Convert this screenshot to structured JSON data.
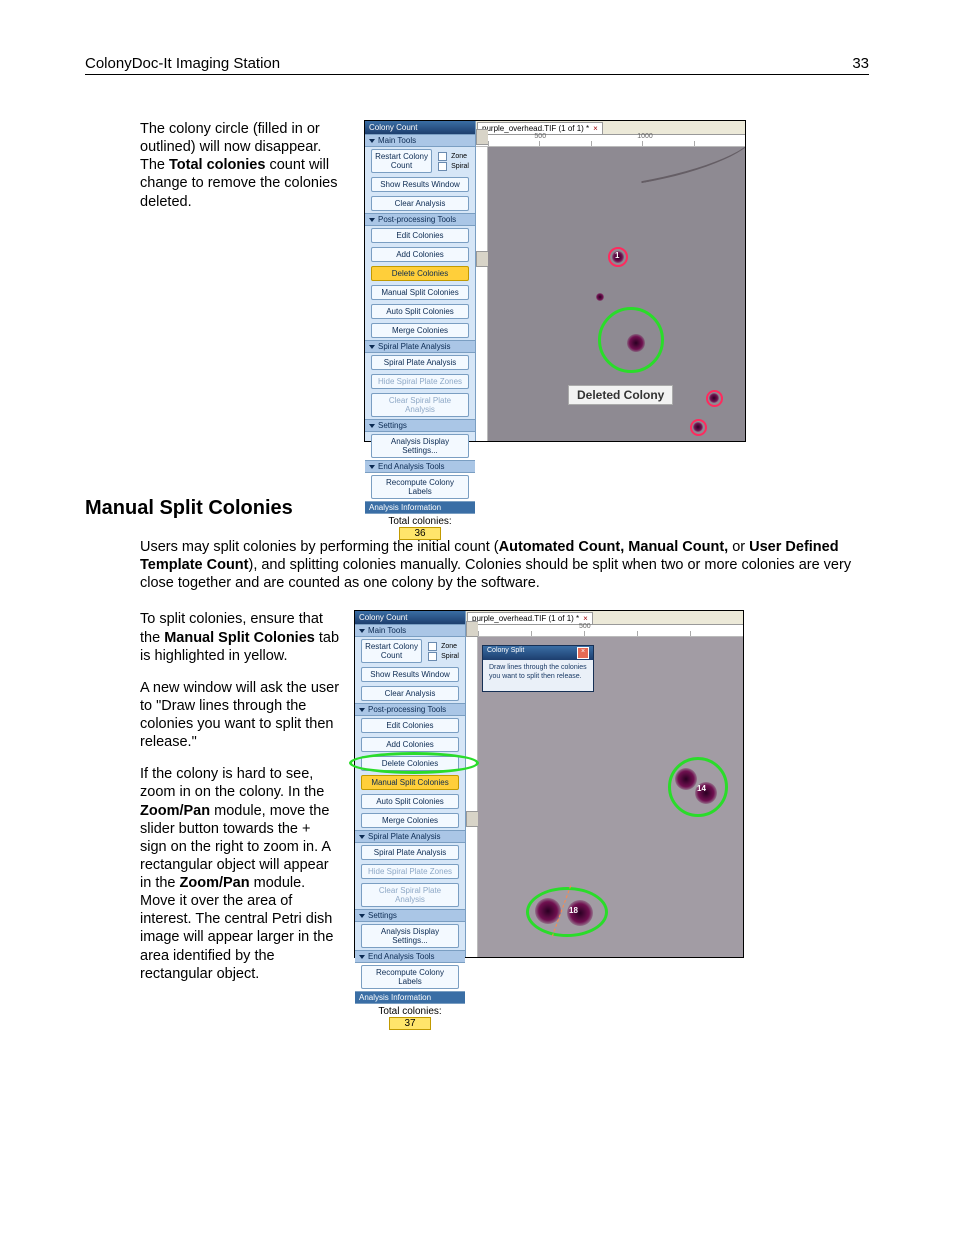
{
  "header": {
    "title": "ColonyDoc-It Imaging Station",
    "page": "33"
  },
  "para1": {
    "line1": "The colony circle (filled in or outlined) will now disappear. The ",
    "bold1": "Total colonies",
    "line2": " count will change to remove the colonies deleted."
  },
  "fig1": {
    "title": "Colony Count",
    "tab": "purple_overhead.TIF (1 of 1) *",
    "ruler": [
      "500",
      "1000"
    ],
    "sidebar": {
      "main": "Main Tools",
      "restart": "Restart Colony Count",
      "zone": "Zone",
      "spiral": "Spiral",
      "show": "Show Results Window",
      "clear": "Clear Analysis",
      "post": "Post-processing Tools",
      "edit": "Edit Colonies",
      "add": "Add Colonies",
      "delete": "Delete Colonies",
      "msplit": "Manual Split Colonies",
      "asplit": "Auto Split Colonies",
      "merge": "Merge Colonies",
      "spa": "Spiral Plate Analysis",
      "spabtn": "Spiral Plate Analysis",
      "hsp": "Hide Spiral Plate Zones",
      "csp": "Clear Spiral Plate Analysis",
      "settings": "Settings",
      "ads": "Analysis Display Settings...",
      "eat": "End Analysis Tools",
      "recompute": "Recompute Colony Labels",
      "info": "Analysis Information",
      "totals_label": "Total colonies:",
      "totals_num": "36"
    },
    "label": "Deleted Colony",
    "colony_id": "1"
  },
  "section2": {
    "heading": "Manual Split Colonies",
    "intro_a": "Users may split colonies by performing the initial count (",
    "intro_b": "Automated Count, Manual Count,",
    "intro_c": " or ",
    "intro_d": "User Defined Template Count",
    "intro_e": "), and splitting colonies manually.  Colonies should be split when two or more colonies are very close together and are counted as one colony by the software.",
    "p1a": "To split colonies, ensure that the ",
    "p1b": "Manual Split Colonies",
    "p1c": " tab is highlighted in yellow.",
    "p2": "A new window will ask the user to \"Draw lines through the colonies you want to split then release.\"",
    "p3a": "If the colony is hard to see, zoom in on the colony.  In the ",
    "p3b": "Zoom/Pan",
    "p3c": " module, move the slider button towards the + sign on the right to zoom in.  A rectangular object will appear in the ",
    "p3d": "Zoom/Pan",
    "p3e": " module. Move it over the area of interest.  The central Petri dish image will appear larger in the area identified by the rectangular object."
  },
  "fig2": {
    "title": "Colony Count",
    "tab": "purple_overhead.TIF (1 of 1) *",
    "ruler": [
      "500"
    ],
    "tooltip_title": "Colony Split",
    "tooltip_body": "Draw lines through the colonies you want to split then release.",
    "sidebar": {
      "main": "Main Tools",
      "restart": "Restart Colony Count",
      "zone": "Zone",
      "spiral": "Spiral",
      "show": "Show Results Window",
      "clear": "Clear Analysis",
      "post": "Post-processing Tools",
      "edit": "Edit Colonies",
      "add": "Add Colonies",
      "delete": "Delete Colonies",
      "msplit": "Manual Split Colonies",
      "asplit": "Auto Split Colonies",
      "merge": "Merge Colonies",
      "spa": "Spiral Plate Analysis",
      "spabtn": "Spiral Plate Analysis",
      "hsp": "Hide Spiral Plate Zones",
      "csp": "Clear Spiral Plate Analysis",
      "settings": "Settings",
      "ads": "Analysis Display Settings...",
      "eat": "End Analysis Tools",
      "recompute": "Recompute Colony Labels",
      "info": "Analysis Information",
      "totals_label": "Total colonies:",
      "totals_num": "37"
    },
    "colony_a": "14",
    "colony_b": "18"
  }
}
